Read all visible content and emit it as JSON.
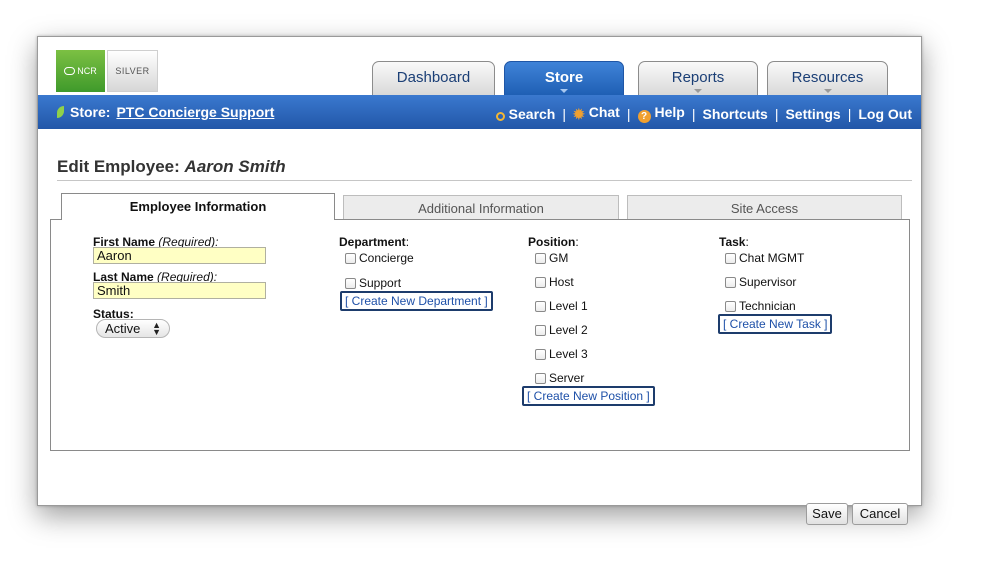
{
  "logos": {
    "ncr": "NCR",
    "silver": "SILVER"
  },
  "top_tabs": [
    {
      "label": "Dashboard",
      "active": false
    },
    {
      "label": "Store",
      "active": true
    },
    {
      "label": "Reports",
      "active": false
    },
    {
      "label": "Resources",
      "active": false
    }
  ],
  "navbar": {
    "store_prefix": "Store:",
    "store_name": "PTC Concierge Support",
    "links": {
      "search": "Search",
      "chat": "Chat",
      "help": "Help",
      "shortcuts": "Shortcuts",
      "settings": "Settings",
      "logout": "Log Out"
    },
    "separator": "|"
  },
  "page": {
    "title_prefix": "Edit Employee:",
    "employee_name": "Aaron Smith"
  },
  "sub_tabs": [
    {
      "label": "Employee Information",
      "active": true
    },
    {
      "label": "Additional Information",
      "active": false
    },
    {
      "label": "Site Access",
      "active": false
    }
  ],
  "form": {
    "first_name": {
      "label": "First Name",
      "hint": "(Required):",
      "value": "Aaron"
    },
    "last_name": {
      "label": "Last Name",
      "hint": "(Required):",
      "value": "Smith"
    },
    "status": {
      "label": "Status",
      "colon": ":",
      "value": "Active"
    },
    "department": {
      "label": "Department",
      "colon": ":",
      "options": [
        "Concierge",
        "Support"
      ],
      "create_link": "[ Create New Department ]"
    },
    "position": {
      "label": "Position",
      "colon": ":",
      "options": [
        "GM",
        "Host",
        "Level 1",
        "Level 2",
        "Level 3",
        "Server"
      ],
      "create_link": "[ Create New Position ]"
    },
    "task": {
      "label": "Task",
      "colon": ":",
      "options": [
        "Chat MGMT",
        "Supervisor",
        "Technician"
      ],
      "create_link": "[ Create New Task ]"
    }
  },
  "buttons": {
    "save": "Save",
    "cancel": "Cancel"
  },
  "colors": {
    "accent_blue": "#2257a8",
    "required_field_bg": "#ffffc4",
    "logo_green": "#5aaa35"
  },
  "icons": {
    "search": "magnifier-icon",
    "chat": "chat-burst-icon",
    "help": "help-icon",
    "store": "leaf-icon"
  }
}
